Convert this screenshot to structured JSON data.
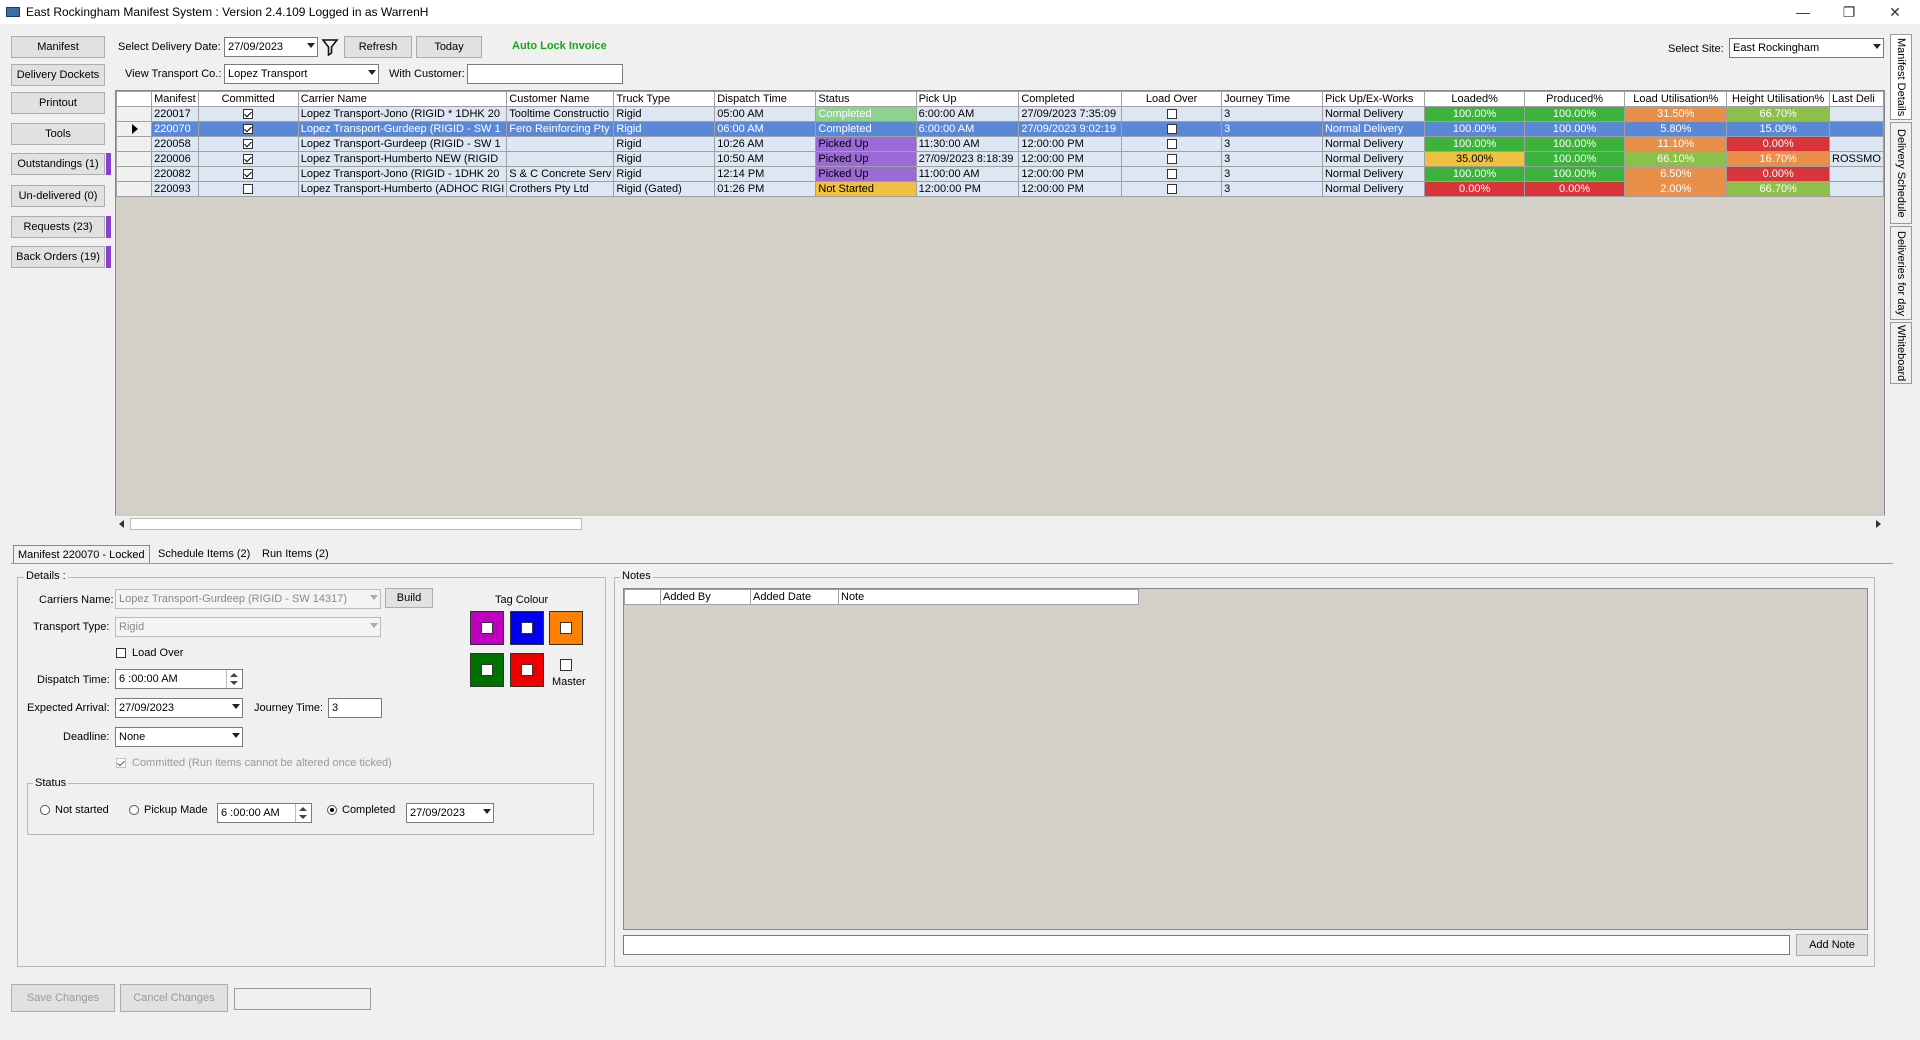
{
  "window": {
    "title": "East Rockingham Manifest System : Version 2.4.109 Logged in as WarrenH",
    "minimize": "—",
    "restore": "❐",
    "close": "✕"
  },
  "nav": {
    "manifest": "Manifest",
    "delivery_dockets": "Delivery Dockets",
    "printout": "Printout",
    "tools": "Tools",
    "outstandings": "Outstandings (1)",
    "undelivered": "Un-delivered (0)",
    "requests": "Requests (23)",
    "back_orders": "Back Orders (19)"
  },
  "toolbar": {
    "select_date_label": "Select Delivery Date:",
    "date_value": "27/09/2023",
    "refresh": "Refresh",
    "today": "Today",
    "auto_lock": "Auto Lock Invoice",
    "transport_label": "View Transport Co.:",
    "transport_value": "Lopez Transport",
    "with_customer_label": "With Customer:",
    "with_customer_value": "",
    "select_site_label": "Select Site:",
    "site_value": "East Rockingham"
  },
  "colors": {
    "completed": "#8fd18f",
    "picked_up": "#9c6ad6",
    "not_started": "#f0c040",
    "green": "#3cb43c",
    "orange": "#e8904a",
    "red": "#d9343a",
    "yellow": "#f0c040",
    "lightgreen": "#8cc04a"
  },
  "grid": {
    "columns": [
      "Manifest",
      "Committed",
      "Carrier Name",
      "Customer Name",
      "Truck Type",
      "Dispatch Time",
      "Status",
      "Pick Up",
      "Completed",
      "Load Over",
      "Journey Time",
      "Pick Up/Ex-Works",
      "Loaded%",
      "Produced%",
      "Load Utilisation%",
      "Height Utilisation%",
      "Last Deli"
    ],
    "rows": [
      {
        "manifest": "220017",
        "committed": true,
        "carrier": "Lopez Transport-Jono (RIGID * 1DHK 20",
        "customer": "Tooltime Constructio",
        "truck": "Rigid",
        "dispatch": "05:00 AM",
        "status": "Completed",
        "status_color": "#8fd18f",
        "pickup": "6:00:00 AM",
        "completed": "27/09/2023 7:35:09",
        "load_over": false,
        "journey": "3",
        "pickup_type": "Normal Delivery",
        "loaded": "100.00%",
        "loaded_c": "#3cb43c",
        "produced": "100.00%",
        "produced_c": "#3cb43c",
        "load_util": "31.50%",
        "load_util_c": "#e8904a",
        "height_util": "66.70%",
        "height_util_c": "#8cc04a",
        "last": "",
        "selected": false
      },
      {
        "manifest": "220070",
        "committed": true,
        "carrier": "Lopez Transport-Gurdeep (RIGID  - SW 1",
        "customer": "Fero Reinforcing Pty",
        "truck": "Rigid",
        "dispatch": "06:00 AM",
        "status": "Completed",
        "status_color": "#8fd18f",
        "pickup": "6:00:00 AM",
        "completed": "27/09/2023 9:02:19",
        "load_over": false,
        "journey": "3",
        "pickup_type": "Normal Delivery",
        "loaded": "100.00%",
        "loaded_c": "#5b88d6",
        "produced": "100.00%",
        "produced_c": "#5b88d6",
        "load_util": "5.80%",
        "load_util_c": "#5b88d6",
        "height_util": "15.00%",
        "height_util_c": "#5b88d6",
        "last": "",
        "selected": true
      },
      {
        "manifest": "220058",
        "committed": true,
        "carrier": "Lopez Transport-Gurdeep (RIGID  - SW 1",
        "customer": "",
        "truck": "Rigid",
        "dispatch": "10:26 AM",
        "status": "Picked Up",
        "status_color": "#9c6ad6",
        "pickup": "11:30:00 AM",
        "completed": "12:00:00 PM",
        "load_over": false,
        "journey": "3",
        "pickup_type": "Normal Delivery",
        "loaded": "100.00%",
        "loaded_c": "#3cb43c",
        "produced": "100.00%",
        "produced_c": "#3cb43c",
        "load_util": "11.10%",
        "load_util_c": "#e8904a",
        "height_util": "0.00%",
        "height_util_c": "#d9343a",
        "last": "",
        "selected": false
      },
      {
        "manifest": "220006",
        "committed": true,
        "carrier": "Lopez Transport-Humberto NEW (RIGID",
        "customer": "",
        "truck": "Rigid",
        "dispatch": "10:50 AM",
        "status": "Picked Up",
        "status_color": "#9c6ad6",
        "pickup": "27/09/2023 8:18:39",
        "completed": "12:00:00 PM",
        "load_over": false,
        "journey": "3",
        "pickup_type": "Normal Delivery",
        "loaded": "35.00%",
        "loaded_c": "#f0c040",
        "produced": "100.00%",
        "produced_c": "#3cb43c",
        "load_util": "66.10%",
        "load_util_c": "#8cc04a",
        "height_util": "16.70%",
        "height_util_c": "#e8904a",
        "last": "ROSSMO",
        "selected": false
      },
      {
        "manifest": "220082",
        "committed": true,
        "carrier": "Lopez Transport-Jono (RIGID - 1DHK 20",
        "customer": "S & C Concrete Serv",
        "truck": "Rigid",
        "dispatch": "12:14 PM",
        "status": "Picked Up",
        "status_color": "#9c6ad6",
        "pickup": "11:00:00 AM",
        "completed": "12:00:00 PM",
        "load_over": false,
        "journey": "3",
        "pickup_type": "Normal Delivery",
        "loaded": "100.00%",
        "loaded_c": "#3cb43c",
        "produced": "100.00%",
        "produced_c": "#3cb43c",
        "load_util": "6.50%",
        "load_util_c": "#e8904a",
        "height_util": "0.00%",
        "height_util_c": "#d9343a",
        "last": "",
        "selected": false
      },
      {
        "manifest": "220093",
        "committed": false,
        "carrier": "Lopez Transport-Humberto (ADHOC RIGI",
        "customer": "Crothers Pty Ltd",
        "truck": "Rigid (Gated)",
        "dispatch": "01:26 PM",
        "status": "Not Started",
        "status_color": "#f0c040",
        "pickup": "12:00:00 PM",
        "completed": "12:00:00 PM",
        "load_over": false,
        "journey": "3",
        "pickup_type": "Normal Delivery",
        "loaded": "0.00%",
        "loaded_c": "#d9343a",
        "produced": "0.00%",
        "produced_c": "#d9343a",
        "load_util": "2.00%",
        "load_util_c": "#e8904a",
        "height_util": "66.70%",
        "height_util_c": "#8cc04a",
        "last": "",
        "selected": false
      }
    ]
  },
  "side_tabs": {
    "manifest_details": "Manifest Details",
    "delivery_schedule": "Delivery Schedule",
    "deliveries_for_day": "Deliveries for day",
    "whiteboard": "Whiteboard"
  },
  "bottom_tabs": {
    "manifest": "Manifest 220070 - Locked",
    "schedule_items": "Schedule Items (2)",
    "run_items": "Run Items (2)"
  },
  "details": {
    "group_label": "Details :",
    "carriers_label": "Carriers Name:",
    "carriers_value": "Lopez Transport-Gurdeep (RIGID  - SW 14317)",
    "build": "Build",
    "transport_type_label": "Transport Type:",
    "transport_type_value": "Rigid",
    "load_over_label": "Load Over",
    "dispatch_label": "Dispatch Time:",
    "dispatch_value": "6 :00:00 AM",
    "expected_label": "Expected Arrival:",
    "expected_value": "27/09/2023",
    "journey_label": "Journey Time:",
    "journey_value": "3",
    "deadline_label": "Deadline:",
    "deadline_value": "None",
    "committed_label": "Committed (Run items cannot be altered once ticked)",
    "tag_colour_label": "Tag Colour",
    "master_label": "Master",
    "tag_colors": [
      "#c000c0",
      "#0000ee",
      "#ff8000",
      "#007000",
      "#ee0000"
    ]
  },
  "status_group": {
    "label": "Status",
    "not_started": "Not started",
    "pickup_made": "Pickup Made",
    "pickup_time": "6 :00:00 AM",
    "completed": "Completed",
    "completed_date": "27/09/2023"
  },
  "notes": {
    "label": "Notes",
    "columns": [
      "Added By",
      "Added Date",
      "Note"
    ],
    "new_note_value": "",
    "add_note": "Add Note"
  },
  "footer": {
    "save": "Save Changes",
    "cancel": "Cancel Changes"
  }
}
